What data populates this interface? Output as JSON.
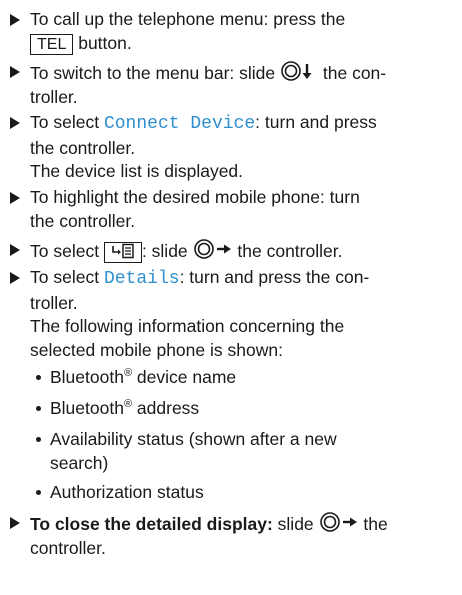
{
  "steps": [
    {
      "before": "To call up the telephone menu: press the",
      "key": "TEL",
      "after": "button."
    },
    {
      "before": "To switch to the menu bar: slide",
      "after": "the con- troller."
    },
    {
      "before": "To select",
      "menu": "Connect Device",
      "after": ": turn and press the controller.",
      "result": "The device list is displayed."
    },
    {
      "text": "To highlight the desired mobile phone: turn the controller."
    },
    {
      "before": "To select",
      "after": ": slide",
      "after2": "the controller."
    },
    {
      "before": "To select",
      "menu": "Details",
      "after": ": turn and press the con- troller.",
      "result": "The following information concerning the selected mobile phone is shown:"
    },
    {
      "bold": "To close the detailed display:",
      "after": "slide",
      "after2": "the controller."
    }
  ],
  "bullets": [
    {
      "before": "Bluetooth",
      "sup": "®",
      "after": " device name"
    },
    {
      "before": "Bluetooth",
      "sup": "®",
      "after": " address"
    },
    {
      "text": "Availability status (shown after a new search)"
    },
    {
      "text": "Authorization status"
    }
  ],
  "icons": {
    "controller_down": "controller-slide-down-icon",
    "controller_right": "controller-slide-right-icon",
    "options": "options-menu-icon"
  }
}
